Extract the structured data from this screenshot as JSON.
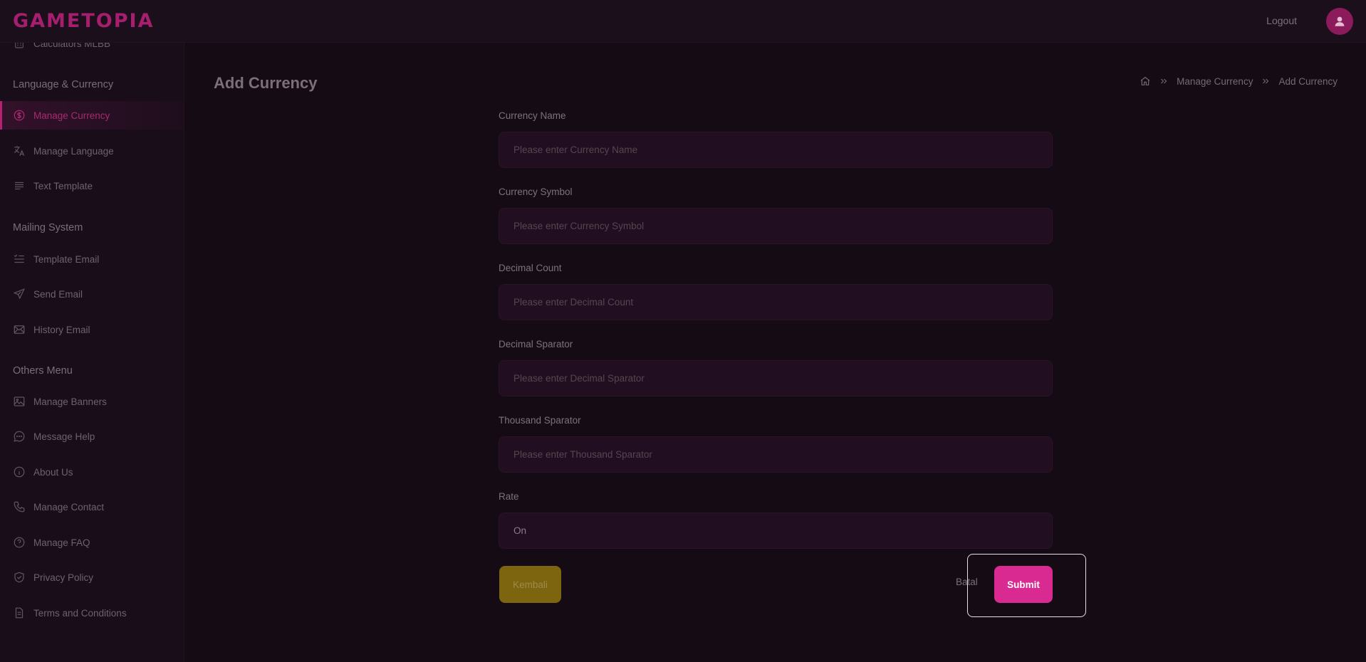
{
  "app": {
    "logo": "GAMETOPIA",
    "logout_label": "Logout"
  },
  "sidebar": {
    "partial_item": {
      "label": "Calculators MLBB",
      "icon": "calculator-icon"
    },
    "sections": [
      {
        "title": "Language & Currency"
      },
      {
        "title": "Mailing System"
      },
      {
        "title": "Others Menu"
      }
    ],
    "items": [
      {
        "label": "Manage Currency",
        "icon": "currency-icon"
      },
      {
        "label": "Manage Language",
        "icon": "translate-icon"
      },
      {
        "label": "Text Template",
        "icon": "text-lines-icon"
      },
      {
        "label": "Template Email",
        "icon": "list-template-icon"
      },
      {
        "label": "Send Email",
        "icon": "send-icon"
      },
      {
        "label": "History Email",
        "icon": "mail-icon"
      },
      {
        "label": "Manage Banners",
        "icon": "image-icon"
      },
      {
        "label": "Message Help",
        "icon": "chat-icon"
      },
      {
        "label": "About Us",
        "icon": "info-icon"
      },
      {
        "label": "Manage Contact",
        "icon": "phone-icon"
      },
      {
        "label": "Manage FAQ",
        "icon": "question-icon"
      },
      {
        "label": "Privacy Policy",
        "icon": "shield-check-icon"
      },
      {
        "label": "Terms and Conditions",
        "icon": "document-icon"
      }
    ],
    "active_item": "Manage Currency"
  },
  "page": {
    "title": "Add Currency",
    "breadcrumb": [
      "Manage Currency",
      "Add Currency"
    ]
  },
  "form": {
    "fields": [
      {
        "label": "Currency Name",
        "placeholder": "Please enter Currency Name",
        "value": ""
      },
      {
        "label": "Currency Symbol",
        "placeholder": "Please enter Currency Symbol",
        "value": ""
      },
      {
        "label": "Decimal Count",
        "placeholder": "Please enter Decimal Count",
        "value": ""
      },
      {
        "label": "Decimal Sparator",
        "placeholder": "Please enter Decimal Sparator",
        "value": ""
      },
      {
        "label": "Thousand Sparator",
        "placeholder": "Please enter Thousand Sparator",
        "value": ""
      },
      {
        "label": "Rate",
        "placeholder": "",
        "value": "On"
      }
    ],
    "back_label": "Kembali",
    "cancel_label": "Batal",
    "submit_label": "Submit"
  },
  "colors": {
    "accent": "#d92a92",
    "active_nav": "#a82a73",
    "back_button": "#7c650e",
    "background": "#150b15"
  }
}
